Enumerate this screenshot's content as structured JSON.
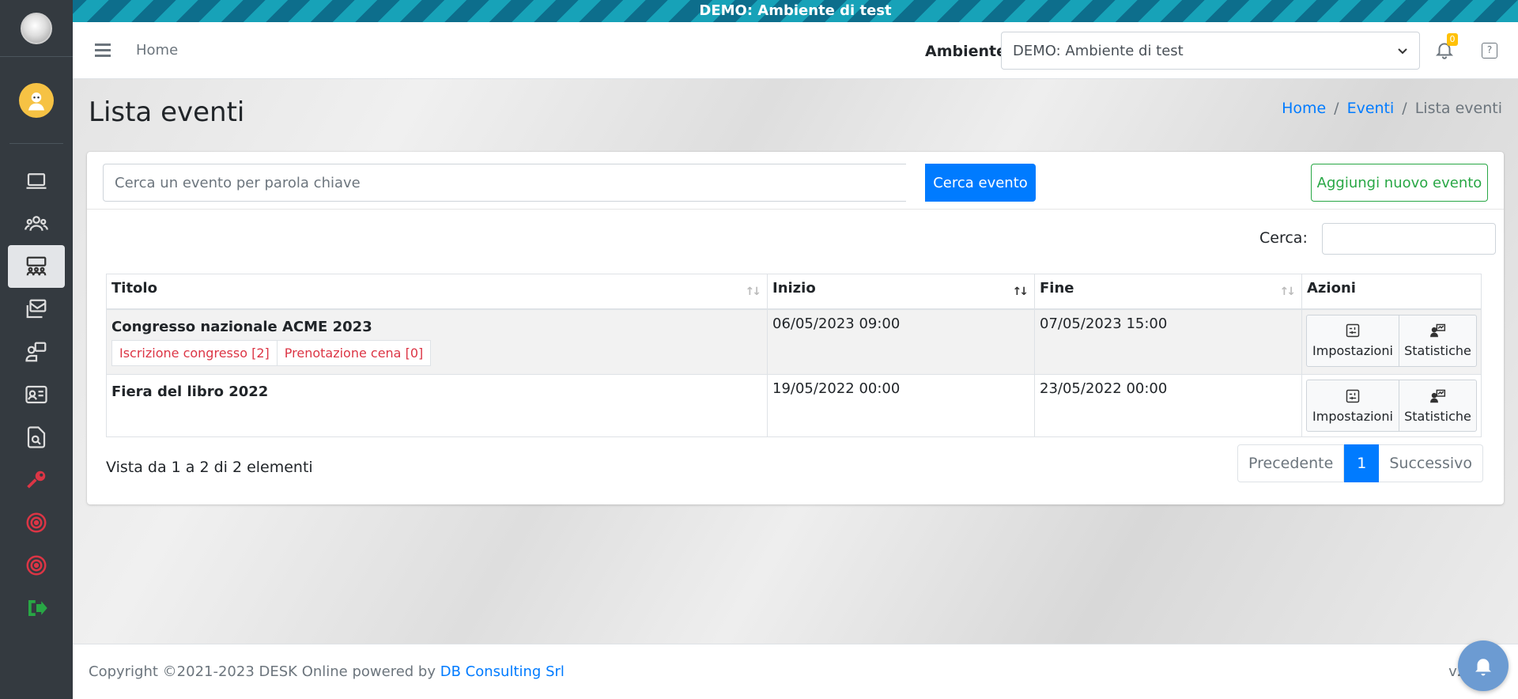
{
  "banner": {
    "text": "DEMO: Ambiente di test"
  },
  "topnav": {
    "home_label": "Home",
    "env_label": "Ambiente:",
    "env_selected": "DEMO: Ambiente di test",
    "notif_count": "0"
  },
  "sidebar": {
    "items": [
      {
        "icon": "laptop-icon"
      },
      {
        "icon": "users-icon"
      },
      {
        "icon": "events-icon",
        "active": true
      },
      {
        "icon": "inbox-icon"
      },
      {
        "icon": "desk-user-icon"
      },
      {
        "icon": "id-card-icon"
      },
      {
        "icon": "document-search-icon"
      },
      {
        "icon": "key-icon"
      },
      {
        "icon": "target-icon"
      },
      {
        "icon": "target-icon"
      },
      {
        "icon": "logout-icon"
      }
    ]
  },
  "page": {
    "title": "Lista eventi",
    "breadcrumb": [
      "Home",
      "Eventi",
      "Lista eventi"
    ]
  },
  "search": {
    "placeholder": "Cerca un evento per parola chiave",
    "button_label": "Cerca evento",
    "add_button_label": "Aggiungi nuovo evento",
    "filter_label": "Cerca:"
  },
  "table": {
    "headers": [
      "Titolo",
      "Inizio",
      "Fine",
      "Azioni"
    ],
    "rows": [
      {
        "title": "Congresso nazionale ACME 2023",
        "start": "06/05/2023 09:00",
        "end": "07/05/2023 15:00",
        "tags": [
          "Iscrizione congresso [2]",
          "Prenotazione cena [0]"
        ],
        "actions": [
          "Impostazioni",
          "Statistiche"
        ]
      },
      {
        "title": "Fiera del libro 2022",
        "start": "19/05/2022 00:00",
        "end": "23/05/2022 00:00",
        "tags": [],
        "actions": [
          "Impostazioni",
          "Statistiche"
        ]
      }
    ],
    "info": "Vista da 1 a 2 di 2 elementi"
  },
  "pager": {
    "prev": "Precedente",
    "current": "1",
    "next": "Successivo"
  },
  "footer": {
    "copyright": "Copyright ©2021-2023 DESK Online powered by ",
    "company": "DB Consulting Srl",
    "version": "v2.10.1"
  },
  "colors": {
    "primary": "#007bff",
    "success": "#28a745",
    "danger": "#dc3545",
    "sidebar": "#343a40"
  }
}
